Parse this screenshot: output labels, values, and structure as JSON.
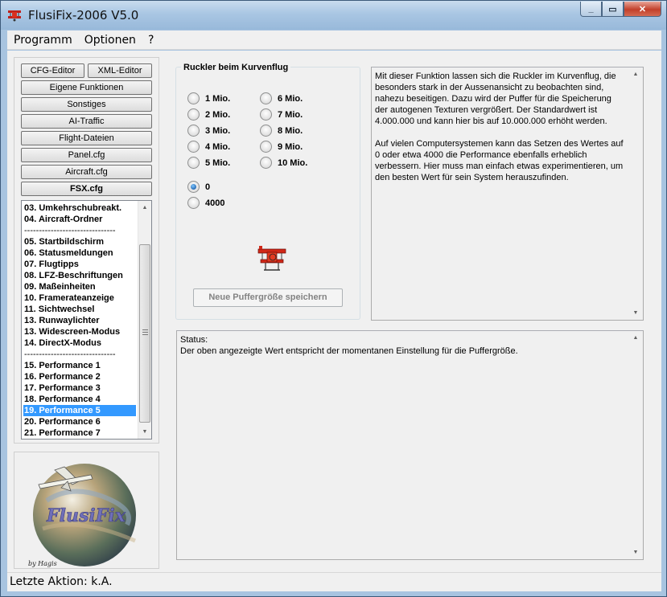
{
  "window": {
    "title": "FlusiFix-2006  V5.0",
    "caption": {
      "minimize": "_",
      "maximize": "▭",
      "close": "✕"
    }
  },
  "menu": [
    "Programm",
    "Optionen",
    "?"
  ],
  "sidebar": {
    "buttons": {
      "cfg_editor": "CFG-Editor",
      "xml_editor": "XML-Editor",
      "own_functions": "Eigene Funktionen",
      "misc": "Sonstiges",
      "ai_traffic": "AI-Traffic",
      "flight_files": "Flight-Dateien",
      "panel_cfg": "Panel.cfg",
      "aircraft_cfg": "Aircraft.cfg",
      "fsx_cfg": "FSX.cfg"
    },
    "list": [
      "03. Umkehrschubreakt.",
      "04. Aircraft-Ordner",
      "-------------------------------",
      "05. Startbildschirm",
      "06. Statusmeldungen",
      "07. Flugtipps",
      "08. LFZ-Beschriftungen",
      "09. Maßeinheiten",
      "10. Framerateanzeige",
      "11. Sichtwechsel",
      "13. Runwaylichter",
      "13. Widescreen-Modus",
      "14. DirectX-Modus",
      "-------------------------------",
      "15. Performance 1",
      "16. Performance 2",
      "17. Performance 3",
      "18. Performance 4",
      "19. Performance 5",
      "20. Performance 6",
      "21. Performance 7"
    ],
    "selected_index": 18,
    "logo_text": "FlusiFix",
    "logo_credit": "by Hagis"
  },
  "group": {
    "title": "Ruckler beim Kurvenflug",
    "options": [
      "1 Mio.",
      "2 Mio.",
      "3 Mio.",
      "4 Mio.",
      "5 Mio.",
      "6 Mio.",
      "7 Mio.",
      "8 Mio.",
      "9 Mio.",
      "10 Mio.",
      "0",
      "4000"
    ],
    "selected": "0",
    "save_button": "Neue Puffergröße speichern"
  },
  "info_text": "Mit dieser Funktion lassen sich die Ruckler im Kurvenflug, die\nbesonders stark in der Aussenansicht zu beobachten sind,\nnahezu beseitigen. Dazu wird der Puffer für die Speicherung\nder autogenen Texturen vergrößert. Der Standardwert ist\n4.000.000 und kann hier bis auf 10.000.000 erhöht werden.\n\nAuf vielen Computersystemen kann das Setzen des Wertes auf\n0 oder etwa 4000 die Performance ebenfalls erheblich\nverbessern. Hier muss man einfach etwas experimentieren, um\nden besten Wert für sein System herauszufinden.",
  "status": {
    "label": "Status:",
    "text": "Der oben angezeigte Wert entspricht der momentanen Einstellung für die Puffergröße."
  },
  "statusbar": "Letzte Aktion: k.A.",
  "colors": {
    "selection": "#3399ff",
    "close_button": "#c2402a",
    "disabled_text": "#838383"
  }
}
